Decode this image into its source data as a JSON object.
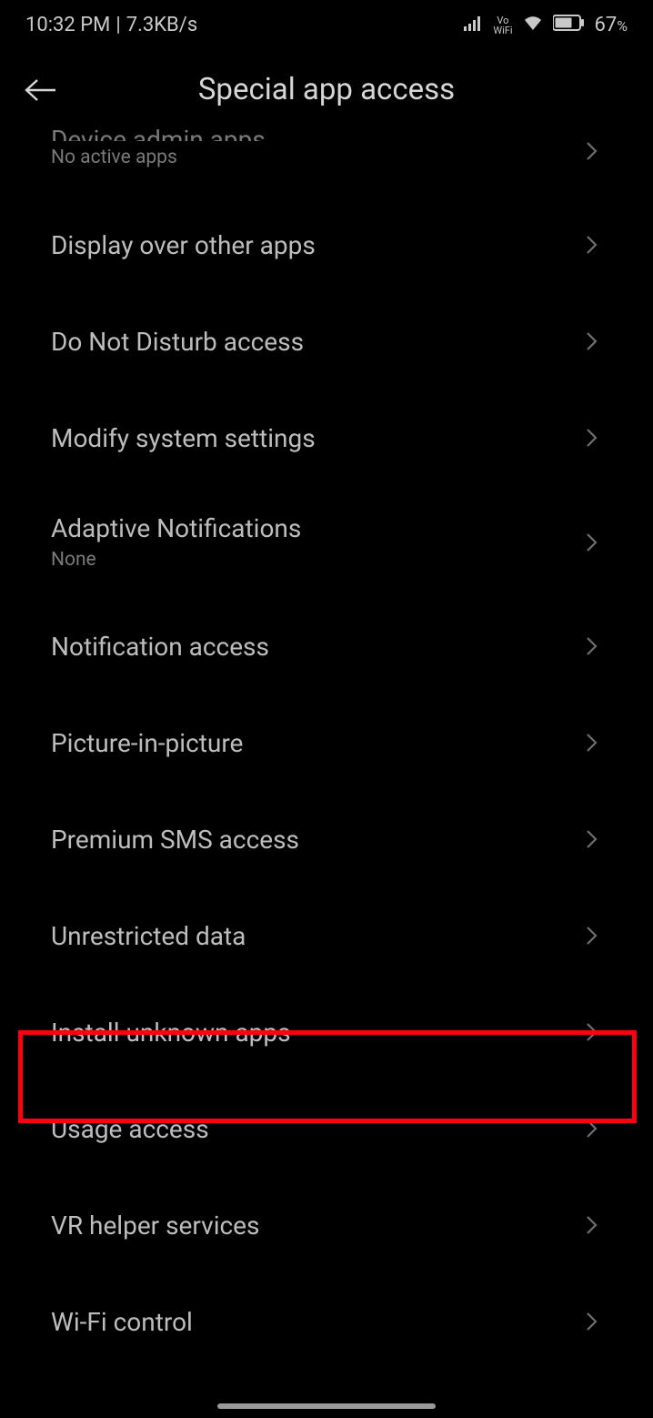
{
  "status": {
    "time": "10:32 PM",
    "net_speed": "7.3KB/s",
    "vowifi_top": "Vo",
    "vowifi_bottom": "WiFi",
    "battery": "67",
    "battery_pct": "%"
  },
  "header": {
    "title": "Special app access"
  },
  "items": [
    {
      "label": "Device admin apps",
      "sublabel": "No active apps",
      "cutoff": true
    },
    {
      "label": "Display over other apps"
    },
    {
      "label": "Do Not Disturb access"
    },
    {
      "label": "Modify system settings"
    },
    {
      "label": "Adaptive Notifications",
      "sublabel": "None"
    },
    {
      "label": "Notification access"
    },
    {
      "label": "Picture-in-picture"
    },
    {
      "label": "Premium SMS access"
    },
    {
      "label": "Unrestricted data"
    },
    {
      "label": "Install unknown apps",
      "highlighted": true
    },
    {
      "label": "Usage access"
    },
    {
      "label": "VR helper services"
    },
    {
      "label": "Wi-Fi control"
    }
  ]
}
